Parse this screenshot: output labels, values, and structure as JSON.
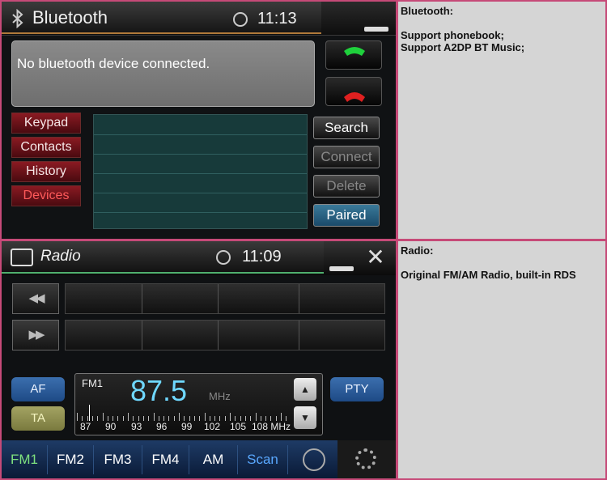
{
  "bluetooth": {
    "title": "Bluetooth",
    "time": "11:13",
    "message": "No bluetooth device connected.",
    "nav": [
      "Keypad",
      "Contacts",
      "History",
      "Devices"
    ],
    "actions": [
      "Search",
      "Connect",
      "Delete",
      "Paired"
    ]
  },
  "bluetooth_notes": {
    "heading": "Bluetooth:",
    "lines": "Support phonebook;\nSupport A2DP BT Music;"
  },
  "radio": {
    "title": "Radio",
    "time": "11:09",
    "af": "AF",
    "ta": "TA",
    "pty": "PTY",
    "band": "FM1",
    "frequency": "87.5",
    "unit": "MHz",
    "scale": [
      "87",
      "90",
      "93",
      "96",
      "99",
      "102",
      "105",
      "108 MHz"
    ],
    "tabs": [
      "FM1",
      "FM2",
      "FM3",
      "FM4",
      "AM",
      "Scan"
    ],
    "seek_prev_icon": "skip-back-icon",
    "seek_next_icon": "skip-forward-icon"
  },
  "radio_notes": {
    "heading": "Radio:",
    "lines": "Original FM/AM Radio, built-in RDS"
  },
  "colors": {
    "frame": "#c64a78",
    "freq_text": "#6fd8ff",
    "active_tab": "#7ee07e",
    "scan_tab": "#59a8ff"
  }
}
